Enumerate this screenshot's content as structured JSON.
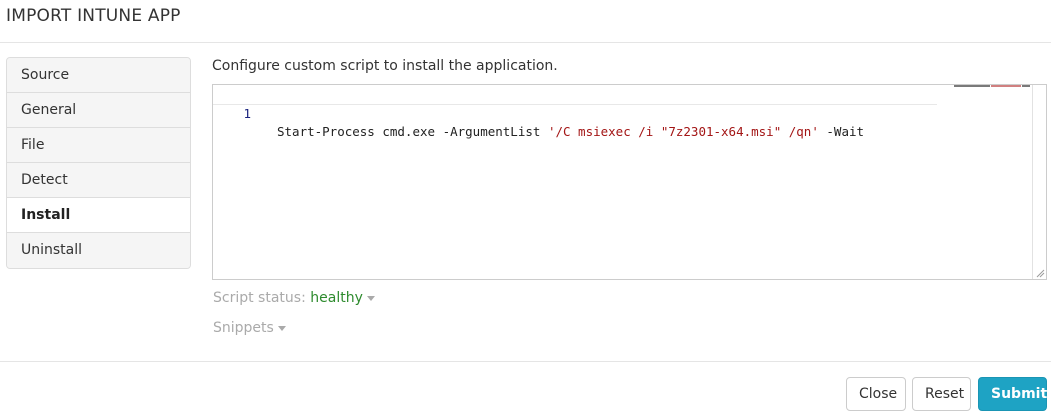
{
  "dialog": {
    "title": "IMPORT INTUNE APP"
  },
  "nav": {
    "items": [
      {
        "label": "Source"
      },
      {
        "label": "General"
      },
      {
        "label": "File"
      },
      {
        "label": "Detect"
      },
      {
        "label": "Install"
      },
      {
        "label": "Uninstall"
      }
    ],
    "active": "Install"
  },
  "main": {
    "instruction": "Configure custom script to install the application.",
    "editor": {
      "line_number": "1",
      "code_plain_1": "Start-Process cmd.exe -ArgumentList ",
      "code_string": "'/C msiexec /i \"7z2301-x64.msi\" /qn'",
      "code_plain_2": " -Wait"
    },
    "status": {
      "label": "Script status: ",
      "value": "healthy"
    },
    "snippets": {
      "label": "Snippets"
    }
  },
  "footer": {
    "close_label": "Close",
    "reset_label": "Reset",
    "submit_label": "Submit"
  },
  "colors": {
    "accent": "#1ea3c4",
    "healthy": "#2e8b2e",
    "string": "#a31515"
  }
}
